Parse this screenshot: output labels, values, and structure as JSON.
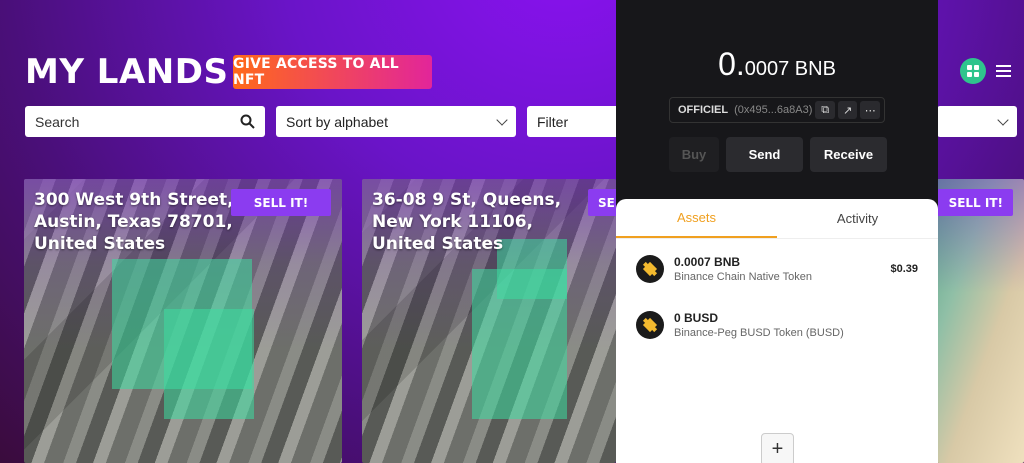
{
  "header": {
    "title": "MY LANDS",
    "access_button": "GIVE ACCESS TO ALL NFT"
  },
  "controls": {
    "search_placeholder": "Search",
    "sort_label": "Sort by alphabet",
    "filter_label": "Filter"
  },
  "cards": [
    {
      "address": "300 West 9th Street, Austin, Texas 78701, United States",
      "sell_label": "SELL IT!"
    },
    {
      "address": "36-08 9 St, Queens, New York 11106, United States",
      "sell_label": "SELL IT!"
    },
    {
      "address": "",
      "sell_label": "SELL IT!"
    }
  ],
  "wallet": {
    "balance_whole": "0.",
    "balance_fraction": "0007 BNB",
    "account_name": "OFFICIEL",
    "account_address": "(0x495...6a8A3)",
    "buttons": {
      "buy": "Buy",
      "send": "Send",
      "receive": "Receive"
    },
    "tabs": {
      "assets": "Assets",
      "activity": "Activity"
    },
    "assets": [
      {
        "amount": "0.0007 BNB",
        "description": "Binance Chain Native Token",
        "value": "$0.39"
      },
      {
        "amount": "0 BUSD",
        "description": "Binance-Peg BUSD Token (BUSD)",
        "value": ""
      }
    ],
    "add_symbol": "+"
  },
  "colors": {
    "accent_green": "#2fc48d",
    "sell_purple": "#8b3cf0",
    "bnb_yellow": "#f3ba2f",
    "tab_active": "#f0a020"
  }
}
